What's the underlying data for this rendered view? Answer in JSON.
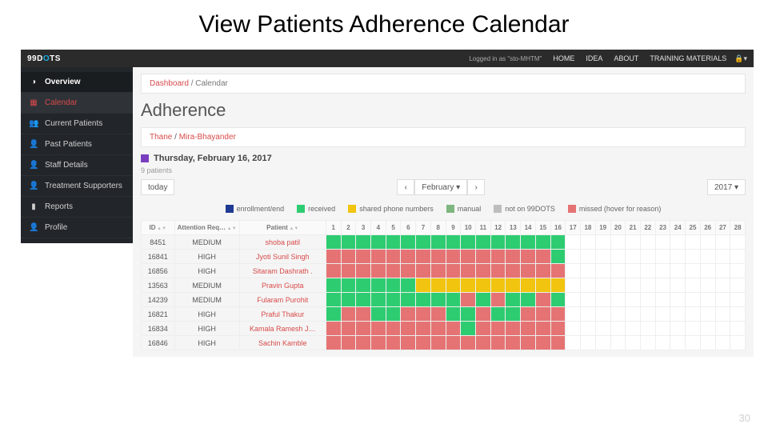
{
  "slide_title": "View Patients Adherence Calendar",
  "brand": "99DOTS",
  "logged_in": "Logged in as \"sto-MHTM\"",
  "topnav": [
    "HOME",
    "IDEA",
    "ABOUT",
    "TRAINING MATERIALS"
  ],
  "sidebar": [
    {
      "icon": "◑",
      "label": "Overview"
    },
    {
      "icon": "▦",
      "label": "Calendar"
    },
    {
      "icon": "👥",
      "label": "Current Patients"
    },
    {
      "icon": "👤",
      "label": "Past Patients"
    },
    {
      "icon": "👤",
      "label": "Staff Details"
    },
    {
      "icon": "👤",
      "label": "Treatment Supporters"
    },
    {
      "icon": "▮",
      "label": "Reports"
    },
    {
      "icon": "👤",
      "label": "Profile"
    }
  ],
  "breadcrumb": {
    "root": "Dashboard",
    "page": "Calendar"
  },
  "section_title": "Adherence",
  "location": {
    "district": "Thane",
    "tu": "Mira-Bhayander"
  },
  "date_header": "Thursday, February 16, 2017",
  "patient_count": "9 patients",
  "controls": {
    "today": "today",
    "prev": "‹",
    "month": "February ▾",
    "next": "›",
    "year": "2017 ▾"
  },
  "legend": [
    {
      "color": "c-enroll",
      "label": "enrollment/end"
    },
    {
      "color": "c-received",
      "label": "received"
    },
    {
      "color": "c-shared",
      "label": "shared phone numbers"
    },
    {
      "color": "c-manual",
      "label": "manual"
    },
    {
      "color": "c-not",
      "label": "not on 99DOTS"
    },
    {
      "color": "c-missed",
      "label": "missed (hover for reason)"
    }
  ],
  "columns": {
    "id": "ID",
    "att": "Attention Req…",
    "pat": "Patient"
  },
  "days": [
    1,
    2,
    3,
    4,
    5,
    6,
    7,
    8,
    9,
    10,
    11,
    12,
    13,
    14,
    15,
    16,
    17,
    18,
    19,
    20,
    21,
    22,
    23,
    24,
    25,
    26,
    27,
    28
  ],
  "today_index": 15,
  "rows": [
    {
      "id": "8451",
      "att": "MEDIUM",
      "patient": "shoba patil",
      "cells": [
        "g",
        "g",
        "g",
        "g",
        "g",
        "g",
        "g",
        "g",
        "g",
        "g",
        "g",
        "g",
        "g",
        "g",
        "g",
        "g",
        "w",
        "w",
        "w",
        "w",
        "w",
        "w",
        "w",
        "w",
        "w",
        "w",
        "w",
        "w"
      ]
    },
    {
      "id": "16841",
      "att": "HIGH",
      "patient": "Jyoti Sunil Singh",
      "cells": [
        "r",
        "r",
        "r",
        "r",
        "r",
        "r",
        "r",
        "r",
        "r",
        "r",
        "r",
        "r",
        "r",
        "r",
        "r",
        "g",
        "w",
        "w",
        "w",
        "w",
        "w",
        "w",
        "w",
        "w",
        "w",
        "w",
        "w",
        "w"
      ]
    },
    {
      "id": "16856",
      "att": "HIGH",
      "patient": "Sitaram Dashrath .",
      "cells": [
        "r",
        "r",
        "r",
        "r",
        "r",
        "r",
        "r",
        "r",
        "r",
        "r",
        "r",
        "r",
        "r",
        "r",
        "r",
        "r",
        "w",
        "w",
        "w",
        "w",
        "w",
        "w",
        "w",
        "w",
        "w",
        "w",
        "w",
        "w"
      ]
    },
    {
      "id": "13563",
      "att": "MEDIUM",
      "patient": "Pravin Gupta",
      "cells": [
        "g",
        "g",
        "g",
        "g",
        "g",
        "g",
        "y",
        "y",
        "y",
        "y",
        "y",
        "y",
        "y",
        "y",
        "y",
        "y",
        "w",
        "w",
        "w",
        "w",
        "w",
        "w",
        "w",
        "w",
        "w",
        "w",
        "w",
        "w"
      ]
    },
    {
      "id": "14239",
      "att": "MEDIUM",
      "patient": "Fularam Purohit",
      "cells": [
        "g",
        "g",
        "g",
        "g",
        "g",
        "g",
        "g",
        "g",
        "g",
        "r",
        "g",
        "r",
        "g",
        "g",
        "r",
        "g",
        "w",
        "w",
        "w",
        "w",
        "w",
        "w",
        "w",
        "w",
        "w",
        "w",
        "w",
        "w"
      ]
    },
    {
      "id": "16821",
      "att": "HIGH",
      "patient": "Praful Thakur",
      "cells": [
        "g",
        "r",
        "r",
        "g",
        "g",
        "r",
        "r",
        "r",
        "g",
        "g",
        "r",
        "g",
        "g",
        "r",
        "r",
        "r",
        "w",
        "w",
        "w",
        "w",
        "w",
        "w",
        "w",
        "w",
        "w",
        "w",
        "w",
        "w"
      ]
    },
    {
      "id": "16834",
      "att": "HIGH",
      "patient": "Kamala Ramesh J…",
      "cells": [
        "r",
        "r",
        "r",
        "r",
        "r",
        "r",
        "r",
        "r",
        "r",
        "g",
        "r",
        "r",
        "r",
        "r",
        "r",
        "r",
        "w",
        "w",
        "w",
        "w",
        "w",
        "w",
        "w",
        "w",
        "w",
        "w",
        "w",
        "w"
      ]
    },
    {
      "id": "16846",
      "att": "HIGH",
      "patient": "Sachin Kamble",
      "cells": [
        "r",
        "r",
        "r",
        "r",
        "r",
        "r",
        "r",
        "r",
        "r",
        "r",
        "r",
        "r",
        "r",
        "r",
        "r",
        "r",
        "w",
        "w",
        "w",
        "w",
        "w",
        "w",
        "w",
        "w",
        "w",
        "w",
        "w",
        "w"
      ]
    }
  ],
  "page_number": "30"
}
